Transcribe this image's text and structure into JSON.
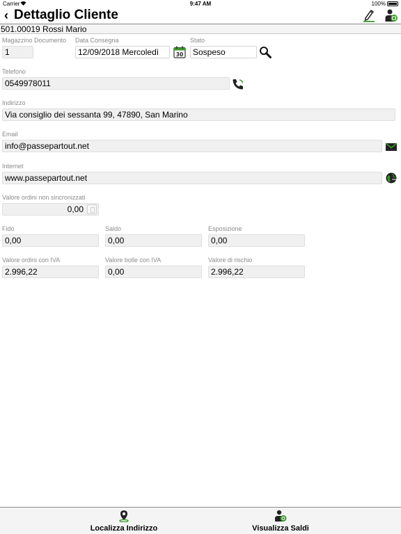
{
  "status_bar": {
    "carrier": "Carrier",
    "time": "9:47 AM",
    "battery": "100%"
  },
  "header": {
    "back": "‹",
    "title": "Dettaglio Cliente",
    "icons": [
      "edit-icon",
      "user-icon"
    ]
  },
  "customer": {
    "code_name": "501.00019 Rossi Mario"
  },
  "fields": {
    "magazzino": {
      "label": "Magazzino Documento",
      "value": "1"
    },
    "data_consegna": {
      "label": "Data Consegna",
      "value": "12/09/2018  Mercoledì"
    },
    "calendar_day": "30",
    "stato": {
      "label": "Stato",
      "value": "Sospeso"
    },
    "telefono": {
      "label": "Telefono",
      "value": "0549978011"
    },
    "indirizzo": {
      "label": "Indirizzo",
      "value": "Via consiglio dei sessanta 99, 47890, San Marino"
    },
    "email": {
      "label": "Email",
      "value": "info@passepartout.net"
    },
    "internet": {
      "label": "Internet",
      "value": "www.passepartout.net"
    },
    "ordini_non_sync": {
      "label": "Valore ordini non sincronizzati",
      "value": "0,00"
    },
    "fido": {
      "label": "Fido",
      "value": "0,00"
    },
    "saldo": {
      "label": "Saldo",
      "value": "0,00"
    },
    "esposizione": {
      "label": "Esposizione",
      "value": "0,00"
    },
    "ordini_iva": {
      "label": "Valore ordini con IVA",
      "value": "2.996,22"
    },
    "bolle_iva": {
      "label": "Valore bolle con IVA",
      "value": "0,00"
    },
    "rischio": {
      "label": "Valore di rischio",
      "value": "2.996,22"
    }
  },
  "bottom_bar": {
    "localizza": "Localizza Indirizzo",
    "saldi": "Visualizza Saldi"
  },
  "colors": {
    "accent_green": "#3a9a2a",
    "label_gray": "#8a8a8a",
    "field_bg": "#f0f0f0"
  }
}
